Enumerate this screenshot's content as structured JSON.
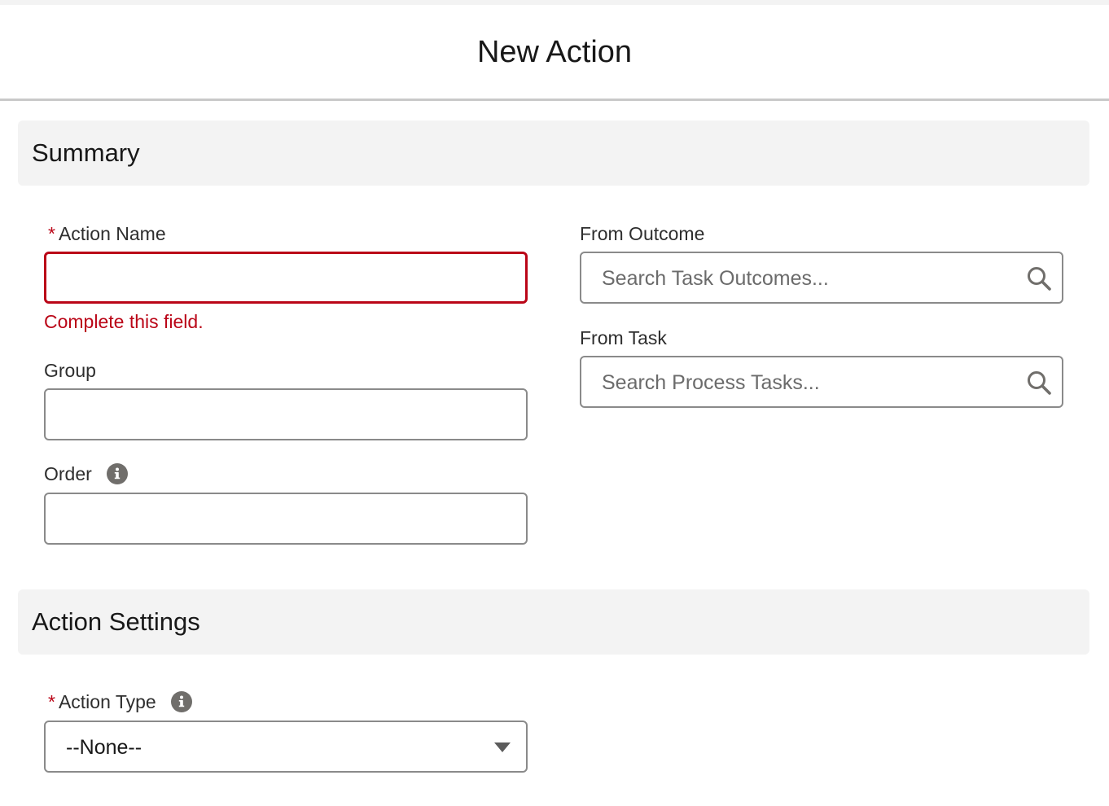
{
  "modal": {
    "title": "New Action"
  },
  "summary": {
    "title": "Summary",
    "action_name": {
      "label": "Action Name",
      "required_mark": "*",
      "value": "",
      "error": "Complete this field."
    },
    "group": {
      "label": "Group",
      "value": ""
    },
    "order": {
      "label": "Order",
      "value": "",
      "info_icon": "info-icon"
    },
    "from_outcome": {
      "label": "From Outcome",
      "placeholder": "Search Task Outcomes...",
      "icon": "search-icon"
    },
    "from_task": {
      "label": "From Task",
      "placeholder": "Search Process Tasks...",
      "icon": "search-icon"
    }
  },
  "action_settings": {
    "title": "Action Settings",
    "action_type": {
      "label": "Action Type",
      "required_mark": "*",
      "selected": "--None--",
      "info_icon": "info-icon",
      "icon": "chevron-down-icon"
    }
  },
  "colors": {
    "error": "#ba0517",
    "section_bg": "#f3f3f3",
    "border": "#8a8a8a"
  }
}
